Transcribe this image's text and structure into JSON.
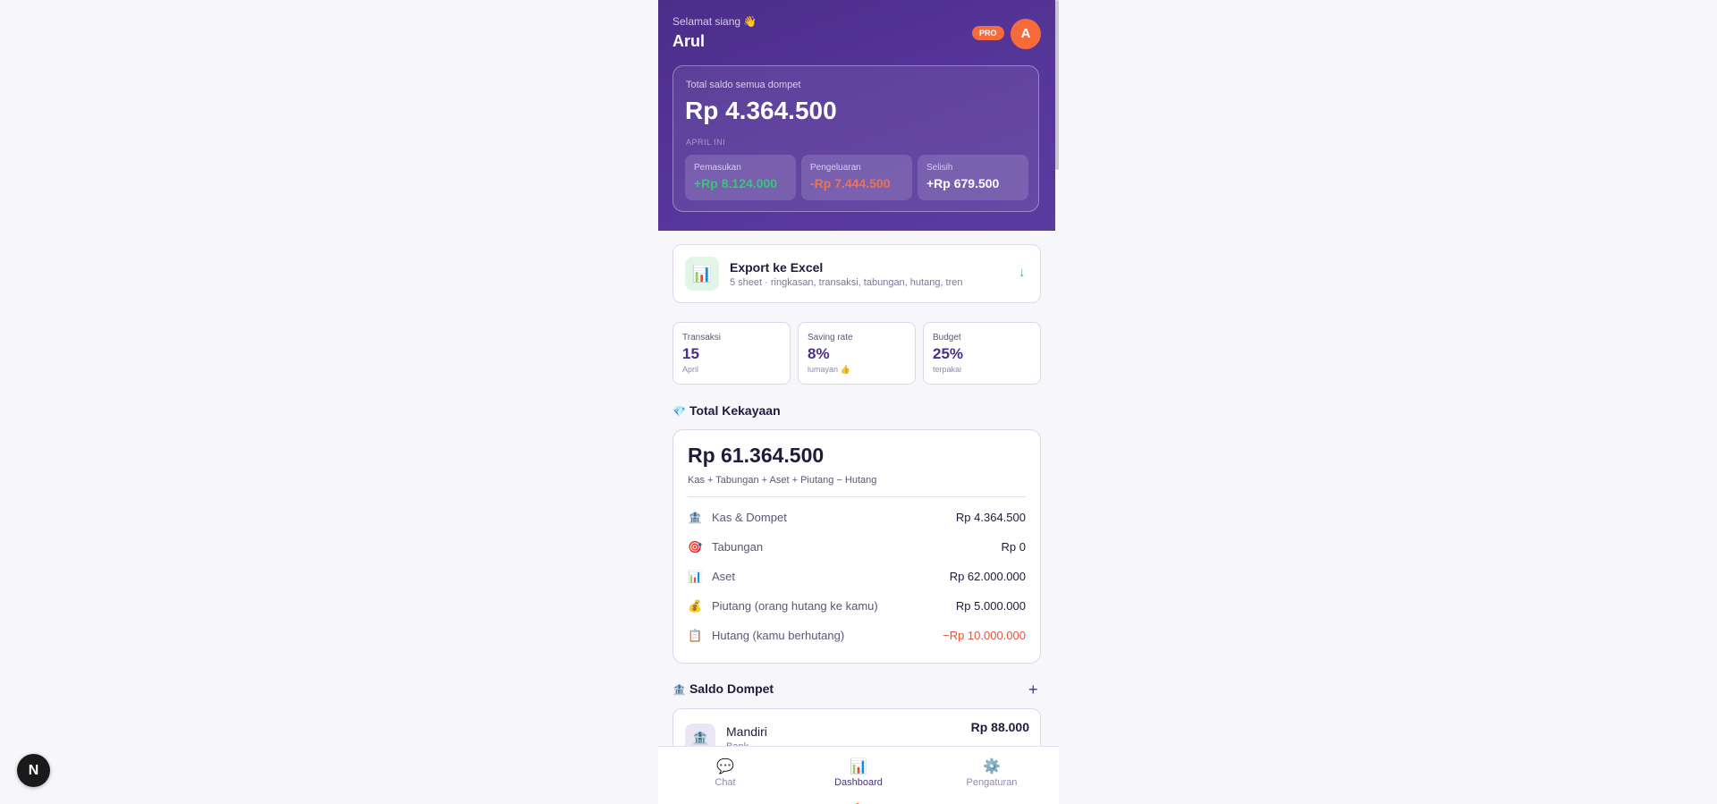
{
  "header": {
    "greeting": "Selamat siang 👋",
    "user_name": "Arul",
    "pro_badge": "PRO",
    "avatar_initial": "A"
  },
  "balance": {
    "label": "Total saldo semua dompet",
    "value": "Rp 4.364.500",
    "month_label": "APRIL INI",
    "income": {
      "label": "Pemasukan",
      "value": "+Rp 8.124.000"
    },
    "expense": {
      "label": "Pengeluaran",
      "value": "-Rp 7.444.500"
    },
    "diff": {
      "label": "Selisih",
      "value": "+Rp 679.500"
    }
  },
  "export": {
    "icon": "📊",
    "title": "Export ke Excel",
    "subtitle": "5 sheet · ringkasan, transaksi, tabungan, hutang, tren",
    "arrow": "↓"
  },
  "stats": [
    {
      "label": "Transaksi",
      "value": "15",
      "sub": "April"
    },
    {
      "label": "Saving rate",
      "value": "8%",
      "sub": "lumayan 👍"
    },
    {
      "label": "Budget",
      "value": "25%",
      "sub": "terpakai"
    }
  ],
  "wealth": {
    "icon": "💎",
    "section_title": "Total Kekayaan",
    "total": "Rp 61.364.500",
    "formula": "Kas + Tabungan + Aset + Piutang − Hutang",
    "rows": [
      {
        "icon": "🏦",
        "label": "Kas & Dompet",
        "value": "Rp 4.364.500"
      },
      {
        "icon": "🎯",
        "label": "Tabungan",
        "value": "Rp 0"
      },
      {
        "icon": "📊",
        "label": "Aset",
        "value": "Rp 62.000.000"
      },
      {
        "icon": "💰",
        "label": "Piutang (orang hutang ke kamu)",
        "value": "Rp 5.000.000"
      },
      {
        "icon": "📋",
        "label": "Hutang (kamu berhutang)",
        "value": "−Rp 10.000.000"
      }
    ]
  },
  "wallets": {
    "icon": "🏦",
    "section_title": "Saldo Dompet",
    "add_label": "+",
    "items": [
      {
        "icon": "🏦",
        "name": "Mandiri",
        "type": "Bank",
        "amount": "Rp 88.000"
      }
    ]
  },
  "nav": [
    {
      "icon": "💬",
      "label": "Chat"
    },
    {
      "icon": "📊",
      "label": "Dashboard"
    },
    {
      "icon": "⚙️",
      "label": "Pengaturan"
    }
  ],
  "dev_badge": "N",
  "colors": {
    "primary": "#4b2d8a",
    "accent": "#f56b3c",
    "income": "#2ecc71",
    "expense": "#f0714a",
    "negative": "#e5533d"
  }
}
